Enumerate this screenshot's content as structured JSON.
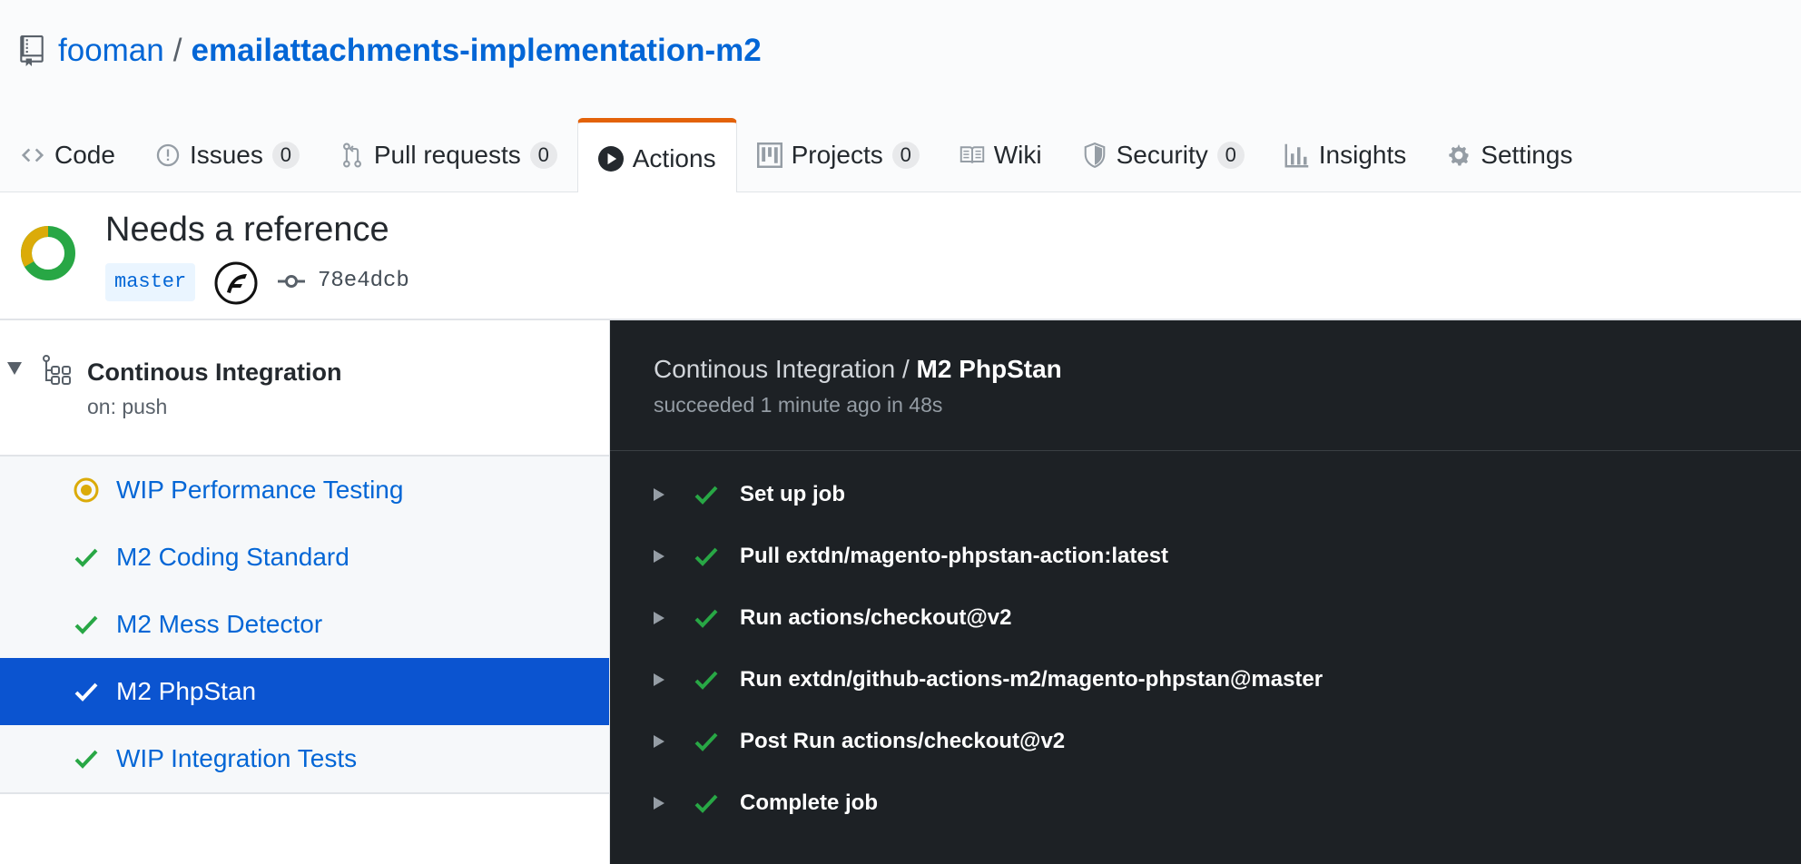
{
  "repo": {
    "owner": "fooman",
    "separator": "/",
    "name": "emailattachments-implementation-m2"
  },
  "tabs": [
    {
      "label": "Code",
      "icon": "code-icon"
    },
    {
      "label": "Issues",
      "count": "0",
      "icon": "issue-icon"
    },
    {
      "label": "Pull requests",
      "count": "0",
      "icon": "pull-request-icon"
    },
    {
      "label": "Actions",
      "icon": "play-icon",
      "selected": true
    },
    {
      "label": "Projects",
      "count": "0",
      "icon": "project-icon"
    },
    {
      "label": "Wiki",
      "icon": "book-icon"
    },
    {
      "label": "Security",
      "count": "0",
      "icon": "shield-icon"
    },
    {
      "label": "Insights",
      "icon": "graph-icon"
    },
    {
      "label": "Settings",
      "icon": "gear-icon"
    }
  ],
  "run": {
    "title": "Needs a reference",
    "branch": "master",
    "commit": "78e4dcb"
  },
  "workflow": {
    "name": "Continous Integration",
    "trigger": "on: push",
    "jobs": [
      {
        "label": "WIP Performance Testing",
        "status": "in-progress"
      },
      {
        "label": "M2 Coding Standard",
        "status": "success"
      },
      {
        "label": "M2 Mess Detector",
        "status": "success"
      },
      {
        "label": "M2 PhpStan",
        "status": "success",
        "active": true
      },
      {
        "label": "WIP Integration Tests",
        "status": "success"
      }
    ]
  },
  "log": {
    "workflow_prefix": "Continous Integration / ",
    "job_name": "M2 PhpStan",
    "status": "succeeded 1 minute ago in 48s",
    "steps": [
      "Set up job",
      "Pull extdn/magento-phpstan-action:latest",
      "Run actions/checkout@v2",
      "Run extdn/github-actions-m2/magento-phpstan@master",
      "Post Run actions/checkout@v2",
      "Complete job"
    ]
  },
  "colors": {
    "link": "#0366d6",
    "accent_tab": "#e36209",
    "success": "#28a745",
    "in_progress": "#dbab09",
    "active_row": "#0b54d0",
    "log_bg": "#1d2125"
  }
}
